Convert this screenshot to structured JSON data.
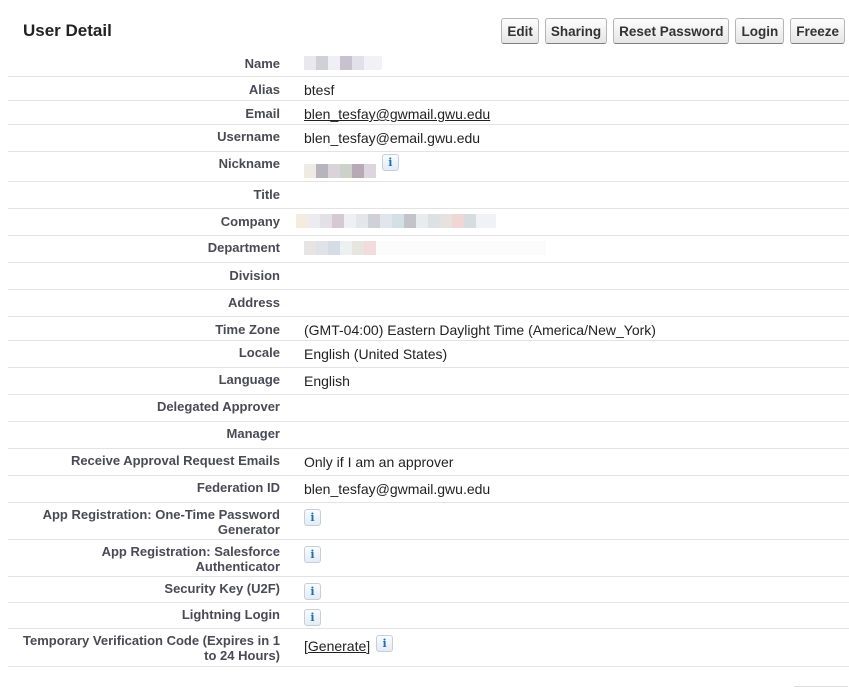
{
  "header": {
    "title": "User Detail",
    "buttons": {
      "edit": "Edit",
      "sharing": "Sharing",
      "reset_password": "Reset Password",
      "login": "Login",
      "freeze": "Freeze"
    }
  },
  "fields": {
    "name": {
      "label": "Name",
      "value": ""
    },
    "alias": {
      "label": "Alias",
      "value": "btesf"
    },
    "email": {
      "label": "Email",
      "value": "blen_tesfay@gwmail.gwu.edu"
    },
    "username": {
      "label": "Username",
      "value": "blen_tesfay@email.gwu.edu"
    },
    "nickname": {
      "label": "Nickname",
      "value": ""
    },
    "title": {
      "label": "Title",
      "value": ""
    },
    "company": {
      "label": "Company",
      "value": ""
    },
    "department": {
      "label": "Department",
      "value": ""
    },
    "division": {
      "label": "Division",
      "value": ""
    },
    "address": {
      "label": "Address",
      "value": ""
    },
    "time_zone": {
      "label": "Time Zone",
      "value": "(GMT-04:00) Eastern Daylight Time (America/New_York)"
    },
    "locale": {
      "label": "Locale",
      "value": "English (United States)"
    },
    "language": {
      "label": "Language",
      "value": "English"
    },
    "delegated_approver": {
      "label": "Delegated Approver",
      "value": ""
    },
    "manager": {
      "label": "Manager",
      "value": ""
    },
    "receive_approval": {
      "label": "Receive Approval Request Emails",
      "value": "Only if I am an approver"
    },
    "federation_id": {
      "label": "Federation ID",
      "value": "blen_tesfay@gwmail.gwu.edu"
    },
    "otp_generator": {
      "label": "App Registration: One-Time Password Generator"
    },
    "sf_authenticator": {
      "label": "App Registration: Salesforce Authenticator"
    },
    "security_key": {
      "label": "Security Key (U2F)"
    },
    "lightning_login": {
      "label": "Lightning Login"
    },
    "temp_code": {
      "label": "Temporary Verification Code (Expires in 1 to 24 Hours)",
      "link_open": "[",
      "link": "Generate",
      "link_close": "]"
    }
  },
  "icons": {
    "info": "info-icon"
  },
  "info_glyph": "i"
}
